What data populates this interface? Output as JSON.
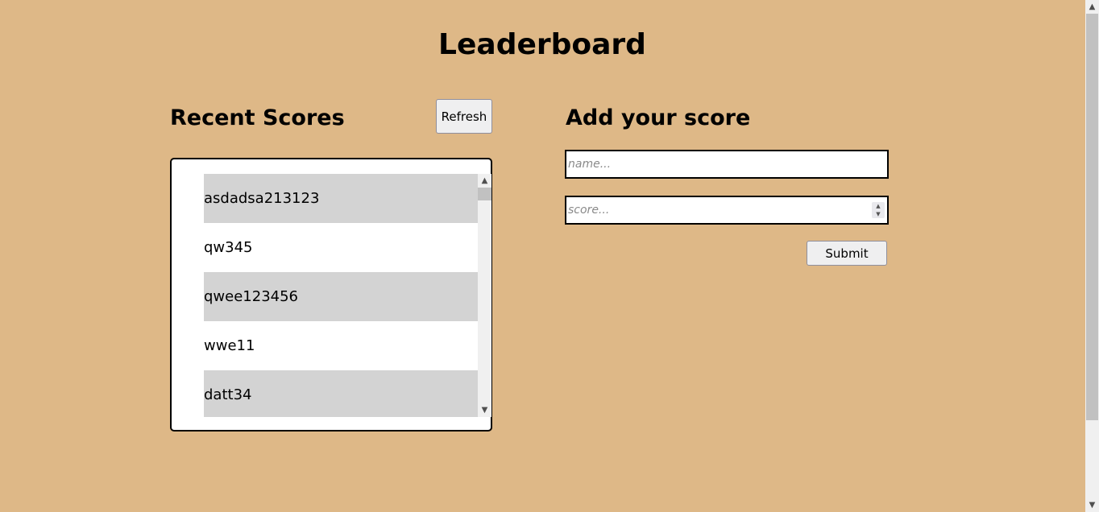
{
  "page": {
    "title": "Leaderboard",
    "background_color": "#deb887"
  },
  "recent_scores": {
    "title": "Recent Scores",
    "refresh_label": "Refresh",
    "entries": [
      {
        "name": "asdadsa213123"
      },
      {
        "name": "qw345"
      },
      {
        "name": "qwee123456"
      },
      {
        "name": "wwe11"
      },
      {
        "name": "datt34"
      }
    ],
    "row_colors": [
      "#d3d3d3",
      "#ffffff"
    ]
  },
  "add_score": {
    "title": "Add your score",
    "name_placeholder": "name...",
    "score_placeholder": "score...",
    "submit_label": "Submit"
  },
  "icons": {
    "scroll_up": "chevron-up-icon",
    "scroll_down": "chevron-down-icon",
    "stepper_up": "chevron-up-icon",
    "stepper_down": "chevron-down-icon"
  }
}
